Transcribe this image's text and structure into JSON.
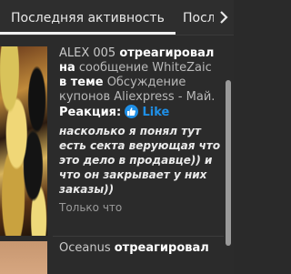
{
  "tabs": [
    {
      "label": "Последняя активность",
      "active": true
    },
    {
      "label": "Посл",
      "active": false
    }
  ],
  "activity": [
    {
      "user": "ALEX 005",
      "action": "отреагировал",
      "prep1": "на",
      "target": "сообщение WhiteZaic",
      "prep2": "в теме",
      "thread": "Обсуждение купонов Aliexpress - Май.",
      "reaction_label": "Реакция:",
      "reaction": "Like",
      "quote": "насколько я понял тут есть секта верующая что это дело в продавце)) и что он закрывает у них заказы))",
      "time": "Только что"
    },
    {
      "user": "Oceanus",
      "action": "отреагировал"
    }
  ],
  "colors": {
    "background": "#2b2b2b",
    "accent_like": "#1f8fe6",
    "scrollbar": "#9a9a9a"
  },
  "icons": {
    "tab_next": "chevron-right-icon",
    "reaction": "thumbs-up-icon"
  }
}
